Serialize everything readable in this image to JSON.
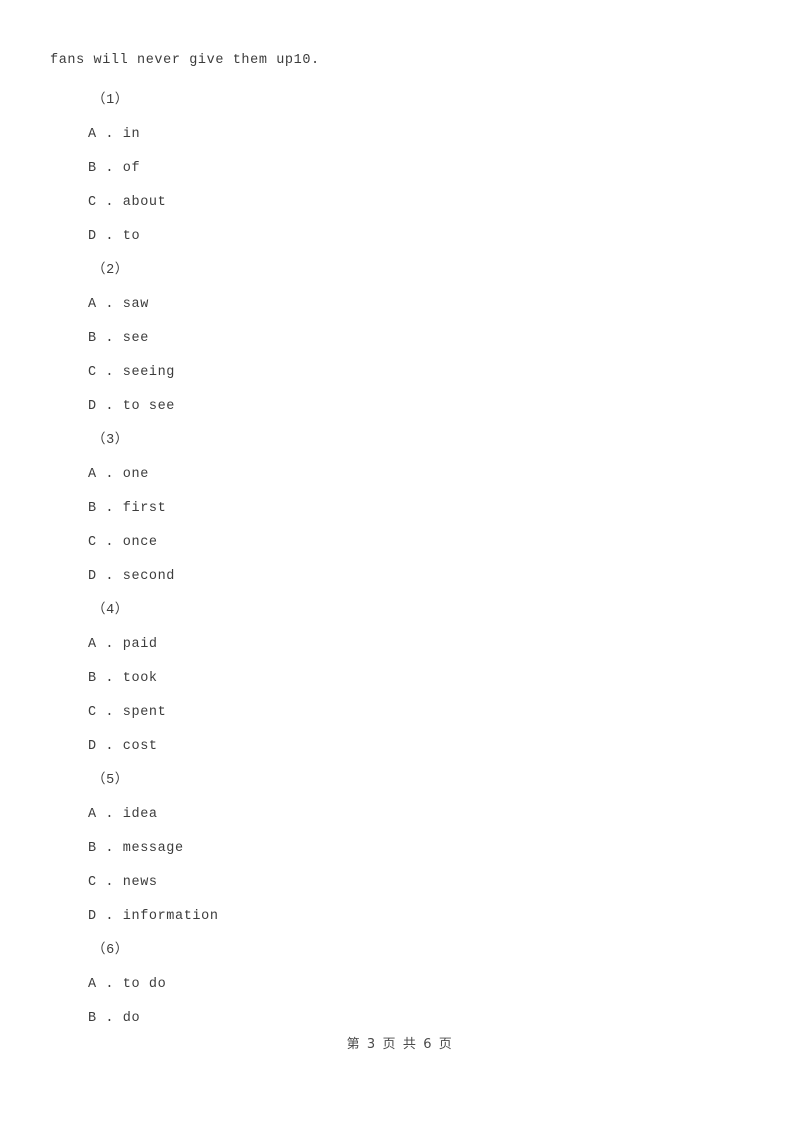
{
  "document": {
    "stem_fragment": "fans will never give them up10.",
    "text_color": "#3c3c3c",
    "page_background": "#ffffff",
    "questions": [
      {
        "number": "（1）",
        "options": [
          "A . in",
          "B . of",
          "C . about",
          "D . to"
        ]
      },
      {
        "number": "（2）",
        "options": [
          "A . saw",
          "B . see",
          "C . seeing",
          "D . to see"
        ]
      },
      {
        "number": "（3）",
        "options": [
          "A . one",
          "B . first",
          "C . once",
          "D . second"
        ]
      },
      {
        "number": "（4）",
        "options": [
          "A . paid",
          "B . took",
          "C . spent",
          "D . cost"
        ]
      },
      {
        "number": "（5）",
        "options": [
          "A . idea",
          "B . message",
          "C . news",
          "D . information"
        ]
      },
      {
        "number": "（6）",
        "options": [
          "A . to do",
          "B . do"
        ]
      }
    ],
    "footer": {
      "page_label": "第 3 页 共 6 页",
      "current_page": "3",
      "total_pages": "6"
    }
  }
}
